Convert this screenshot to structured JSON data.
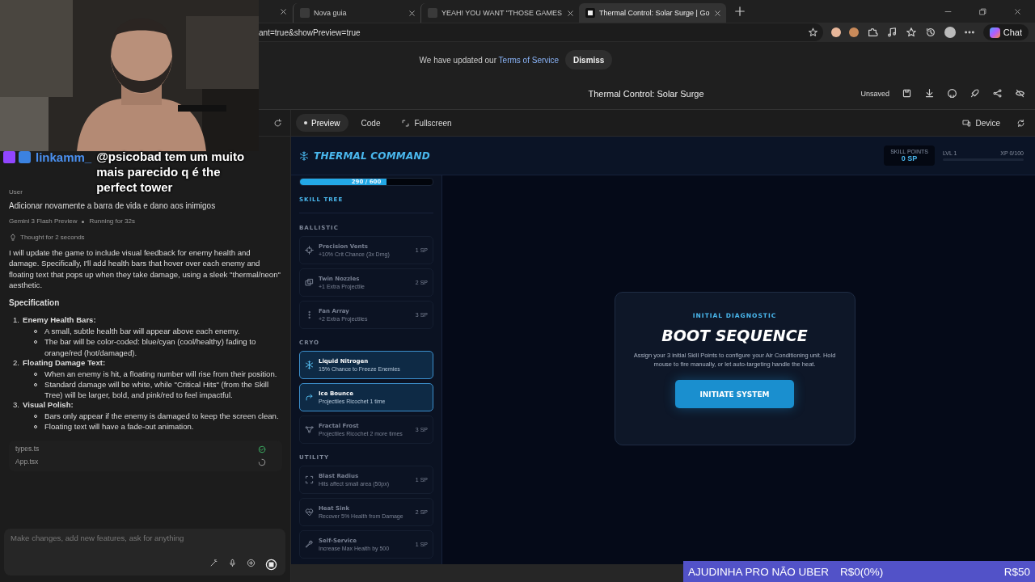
{
  "browser": {
    "tabs": [
      {
        "title": "Nova guia",
        "selected": false
      },
      {
        "title": "YEAH! YOU WANT \"THOSE GAMES",
        "selected": false
      },
      {
        "title": "Thermal Control: Solar Surge | Go",
        "selected": true
      }
    ],
    "url": "ant=true&showPreview=true",
    "chat_button": "Chat"
  },
  "notice": {
    "text": "We have updated our",
    "link": "Terms of Service",
    "button": "Dismiss"
  },
  "app_header": {
    "title": "Thermal Control: Solar Surge",
    "status": "Unsaved"
  },
  "chat_panel": {
    "user_label": "User",
    "user_message": "Adicionar novamente a barra de vida e dano aos inimigos",
    "model": "Gemini 3 Flash Preview",
    "run_status": "Running for 32s",
    "thought": "Thought for 2 seconds",
    "intro": "I will update the game to include visual feedback for enemy health and damage. Specifically, I'll add health bars that hover over each enemy and floating text that pops up when they take damage, using a sleek \"thermal/neon\" aesthetic.",
    "spec_heading": "Specification",
    "spec_items": [
      {
        "number": "1.",
        "title": "Enemy Health Bars:",
        "points": [
          "A small, subtle health bar will appear above each enemy.",
          "The bar will be color-coded: blue/cyan (cool/healthy) fading to orange/red (hot/damaged)."
        ]
      },
      {
        "number": "2.",
        "title": "Floating Damage Text:",
        "points": [
          "When an enemy is hit, a floating number will rise from their position.",
          "Standard damage will be white, while \"Critical Hits\" (from the Skill Tree) will be larger, bold, and pink/red to feel impactful."
        ]
      },
      {
        "number": "3.",
        "title": "Visual Polish:",
        "points": [
          "Bars only appear if the enemy is damaged to keep the screen clean.",
          "Floating text will have a fade-out animation."
        ]
      }
    ],
    "files": [
      {
        "name": "types.ts",
        "done": true
      },
      {
        "name": "App.tsx",
        "done": false
      }
    ],
    "input": {
      "placeholder": "Make changes, add new features, ask for anything"
    }
  },
  "preview_toolbar": {
    "tabs": [
      {
        "label": "Preview",
        "selected": true
      },
      {
        "label": "Code",
        "selected": false
      }
    ],
    "fullscreen": "Fullscreen",
    "device": "Device"
  },
  "game": {
    "title": "THERMAL COMMAND",
    "skill_points_label": "SKILL POINTS",
    "skill_points": "0 SP",
    "level": "LVL 1",
    "xp": "XP 0/100",
    "heat_bar": {
      "text": "290 / 600",
      "level": 0.65
    },
    "skill_tree_label": "SKILL TREE",
    "sections": [
      {
        "name": "BALLISTIC",
        "skills": [
          {
            "name": "Precision Vents",
            "description": "+10% Crit Chance (3x Dmg)",
            "cost": "1 SP",
            "unlocked": false
          },
          {
            "name": "Twin Nozzles",
            "description": "+1 Extra Projectile",
            "cost": "2 SP",
            "unlocked": false
          },
          {
            "name": "Fan Array",
            "description": "+2 Extra Projectiles",
            "cost": "3 SP",
            "unlocked": false
          }
        ]
      },
      {
        "name": "CRYO",
        "skills": [
          {
            "name": "Liquid Nitrogen",
            "description": "15% Chance to Freeze Enemies",
            "unlocked": true
          },
          {
            "name": "Ice Bounce",
            "description": "Projectiles Ricochet 1 time",
            "unlocked": true
          },
          {
            "name": "Fractal Frost",
            "description": "Projectiles Ricochet 2 more times",
            "cost": "3 SP",
            "unlocked": false
          }
        ]
      },
      {
        "name": "UTILITY",
        "skills": [
          {
            "name": "Blast Radius",
            "description": "Hits affect small area (50px)",
            "cost": "1 SP",
            "unlocked": false
          },
          {
            "name": "Heat Sink",
            "description": "Recover 5% Health from Damage",
            "cost": "2 SP",
            "unlocked": false
          },
          {
            "name": "Self-Service",
            "description": "Increase Max Health by 500",
            "cost": "1 SP",
            "unlocked": false
          }
        ]
      }
    ],
    "modal": {
      "eyebrow": "INITIAL DIAGNOSTIC",
      "title": "BOOT SEQUENCE",
      "text": "Assign your 3 initial Skill Points to configure your Air Conditioning unit. Hold mouse to fire manually, or let auto-targeting handle the heat.",
      "button": "INITIATE SYSTEM"
    }
  },
  "stream_overlay": {
    "chat": {
      "user": "linkamm_",
      "message": "@psicobad tem um muito mais parecido q é the perfect tower"
    },
    "donation_goal": {
      "title": "AJUDINHA PRO NÃO UBER",
      "raised": "R$0(0%)",
      "goal": "R$50"
    }
  }
}
